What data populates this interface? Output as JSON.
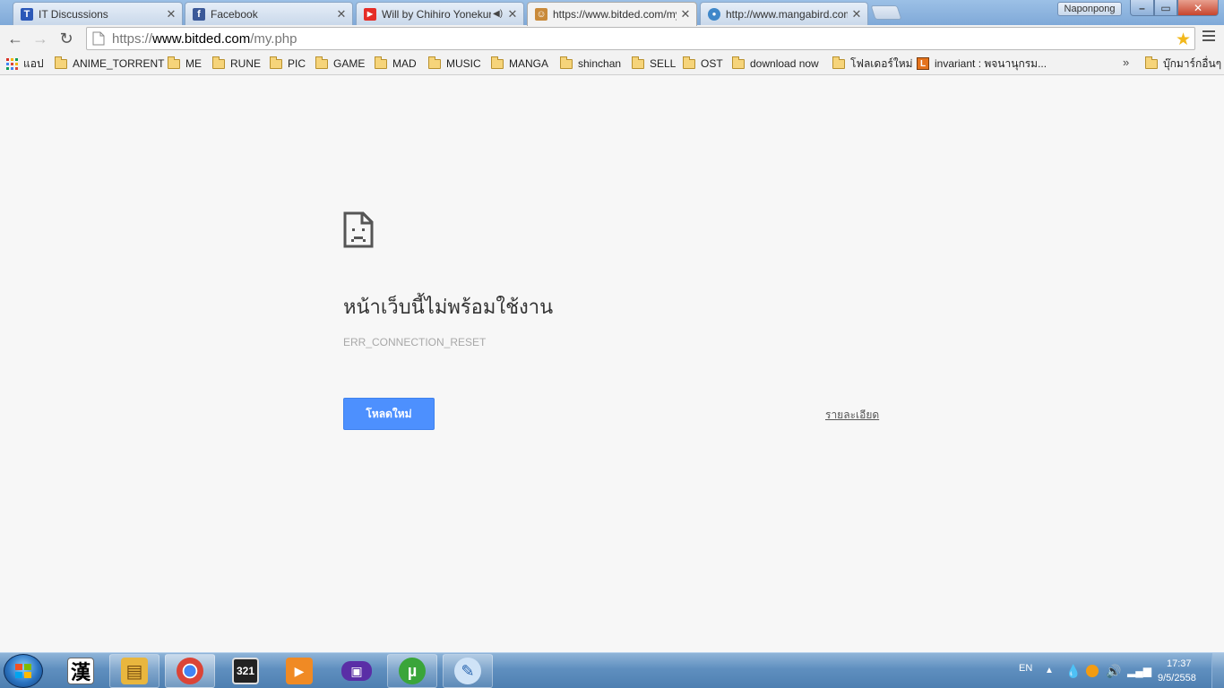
{
  "tabs": [
    {
      "title": "IT Discussions",
      "favicon_text": "T",
      "favicon_color": "#2b58b8"
    },
    {
      "title": "Facebook",
      "favicon_text": "f",
      "favicon_color": "#3b5998"
    },
    {
      "title": "Will by Chihiro Yonekura",
      "favicon_text": "▶",
      "favicon_color": "#e52d27"
    },
    {
      "title": "https://www.bitded.com/my.php",
      "favicon_text": "☺",
      "favicon_color": "#c98a3a"
    },
    {
      "title": "http://www.mangabird.com",
      "favicon_text": "●",
      "favicon_color": "#3f87c9"
    }
  ],
  "profile_name": "Naponpong",
  "window_buttons": {
    "minimize": "–",
    "maximize": "▭",
    "close": "✕"
  },
  "toolbar": {
    "back": "←",
    "forward": "→",
    "reload": "↻",
    "url_scheme": "https://",
    "url_host": "www.bitded.com",
    "url_path": "/my.php",
    "star": "★"
  },
  "bookmarks": {
    "apps_label": "แอป",
    "folders": [
      "ANIME_TORRENT",
      "ME",
      "RUNE",
      "PIC",
      "GAME",
      "MAD",
      "MUSIC",
      "MANGA",
      "shinchan",
      "SELL",
      "OST",
      "download now",
      "โฟลเดอร์ใหม่"
    ],
    "link_label": "invariant : พจนานุกรม...",
    "link_favicon": "L",
    "overflow": "»",
    "other_bookmarks": "บุ๊กมาร์กอื่นๆ"
  },
  "error_page": {
    "heading": "หน้าเว็บนี้ไม่พร้อมใช้งาน",
    "code": "ERR_CONNECTION_RESET",
    "reload_label": "โหลดใหม่",
    "details_label": "รายละเอียด"
  },
  "taskbar": {
    "items": [
      {
        "name": "kanji-app",
        "glyph": "漢",
        "color": "#ffffff",
        "text_color": "#000000"
      },
      {
        "name": "file-explorer",
        "glyph": "▤",
        "color": "#e9b63e",
        "text_color": "#7a5010"
      },
      {
        "name": "chrome",
        "glyph": "◉",
        "color": "#db4437",
        "text_color": "#ffffff"
      },
      {
        "name": "media-player-classic",
        "glyph": "321",
        "color": "#222222",
        "text_color": "#ffffff"
      },
      {
        "name": "video-player",
        "glyph": "▶",
        "color": "#f08a24",
        "text_color": "#ffffff"
      },
      {
        "name": "gba-emulator",
        "glyph": "▣",
        "color": "#5a2ea6",
        "text_color": "#ffffff"
      },
      {
        "name": "utorrent",
        "glyph": "µ",
        "color": "#3aa53a",
        "text_color": "#ffffff"
      },
      {
        "name": "paint",
        "glyph": "✎",
        "color": "#cfe3f7",
        "text_color": "#2a66b0"
      }
    ],
    "language": "EN",
    "time": "17:37",
    "date": "9/5/2558"
  }
}
